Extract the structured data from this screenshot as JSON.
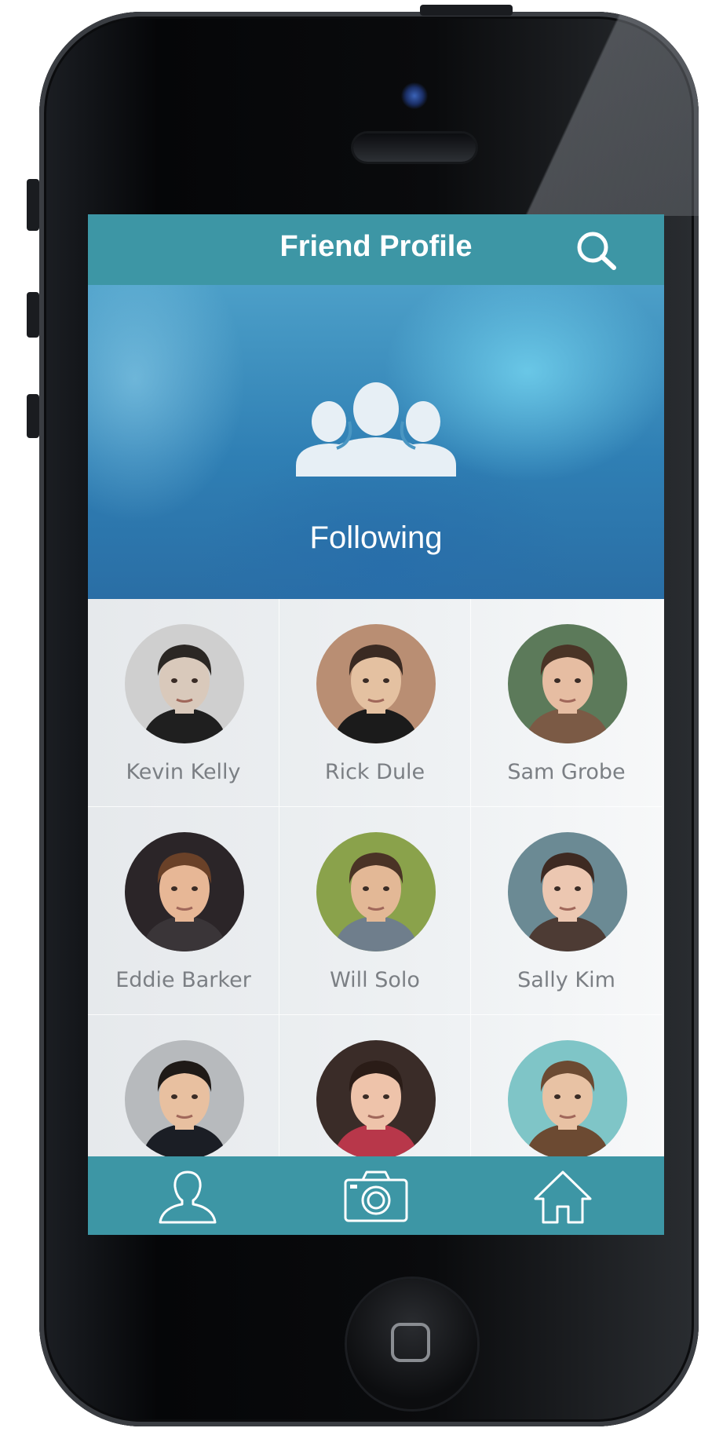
{
  "header": {
    "title": "Friend Profile"
  },
  "hero": {
    "label": "Following"
  },
  "friends": [
    {
      "name": "Kevin Kelly",
      "skin": "#d9c9bb",
      "hair": "#2b2724",
      "bg": "#cfcfcf",
      "shirt": "#1f1f1f"
    },
    {
      "name": "Rick Dule",
      "skin": "#e4c1a1",
      "hair": "#3a2a22",
      "bg": "#b98e73",
      "shirt": "#1b1b1b"
    },
    {
      "name": "Sam Grobe",
      "skin": "#e6bda2",
      "hair": "#4a3426",
      "bg": "#5c7a5a",
      "shirt": "#7b5a45"
    },
    {
      "name": "Eddie Barker",
      "skin": "#e7b796",
      "hair": "#6a4128",
      "bg": "#2b2528",
      "shirt": "#3a3538"
    },
    {
      "name": "Will Solo",
      "skin": "#e3b896",
      "hair": "#4a3326",
      "bg": "#8aa24b",
      "shirt": "#6f7e8c"
    },
    {
      "name": "Sally Kim",
      "skin": "#ecc7b1",
      "hair": "#3e2a22",
      "bg": "#6b8a94",
      "shirt": "#4d3b34"
    },
    {
      "name": "",
      "skin": "#e8c0a0",
      "hair": "#1f1a17",
      "bg": "#b7babd",
      "shirt": "#1b1e25"
    },
    {
      "name": "",
      "skin": "#eec3aa",
      "hair": "#2a1c17",
      "bg": "#3a2c28",
      "shirt": "#b8374a"
    },
    {
      "name": "",
      "skin": "#e8c2a4",
      "hair": "#6c4a32",
      "bg": "#7fc5c7",
      "shirt": "#6c4a32"
    }
  ],
  "icons": {
    "search": "search-icon",
    "following": "group-icon",
    "tab_profile": "person-icon",
    "tab_camera": "camera-icon",
    "tab_home": "home-icon"
  },
  "colors": {
    "accent": "#3d96a5",
    "name_text": "#7b7f84"
  }
}
